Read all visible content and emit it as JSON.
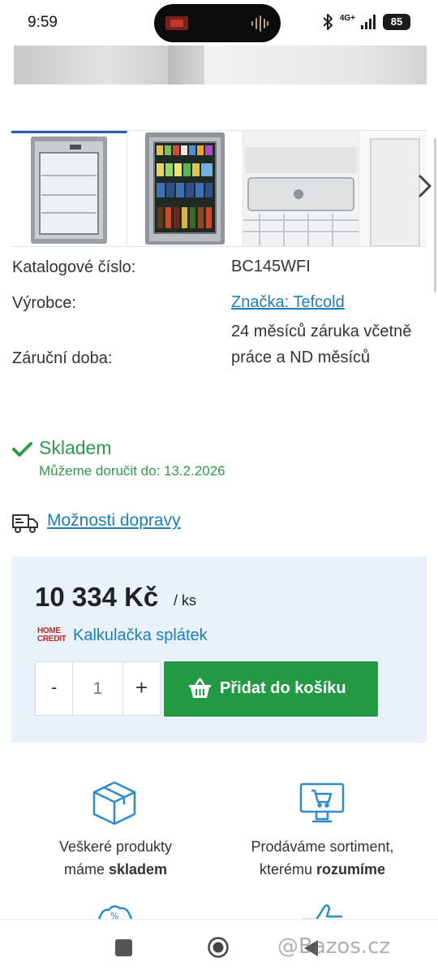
{
  "status_bar": {
    "time": "9:59",
    "network": "4G+",
    "battery": "85",
    "icons": [
      "app-notification-icon",
      "audio-wave-icon",
      "bluetooth-icon",
      "signal-icon",
      "battery-icon"
    ]
  },
  "gallery": {
    "thumbnails": [
      "glass-door-fridge-empty",
      "glass-door-fridge-stocked",
      "fridge-interior-detail",
      "fridge-side-detail"
    ],
    "next_icon": "chevron-right-icon",
    "active_color": "#2b5ea7"
  },
  "specs": {
    "rows": [
      {
        "label": "Katalogové číslo:",
        "value": "BC145WFI"
      },
      {
        "label": "Výrobce:",
        "value": "Značka: Tefcold"
      },
      {
        "label": "Záruční doba:",
        "value": "24 měsíců záruka včetně práce a ND měsíců"
      }
    ]
  },
  "stock": {
    "icon": "checkmark-icon",
    "title": "Skladem",
    "delivery": "Můžeme doručit do: 13.2.2026",
    "color": "#2e9c4a"
  },
  "shipping": {
    "icon": "truck-icon",
    "link": "Možnosti dopravy"
  },
  "purchase": {
    "price": "10 334 Kč",
    "unit": "/ ks",
    "home_credit": {
      "line1": "HOME",
      "line2": "CREDIT"
    },
    "calculator_link": "Kalkulačka splátek",
    "qty_minus": "-",
    "qty_value": "1",
    "qty_plus": "+",
    "add_to_cart": "Přidat do košíku",
    "button_color": "#229a44",
    "box_color": "#e9f2fa"
  },
  "features": [
    {
      "icon": "box-icon",
      "line1": "Veškeré produkty",
      "line2_prefix": "máme ",
      "line2_bold": "skladem"
    },
    {
      "icon": "monitor-cart-icon",
      "line1": "Prodáváme sortiment,",
      "line2_prefix": "kterému ",
      "line2_bold": "rozumíme"
    }
  ],
  "watermark": "@Bazos.cz",
  "colors": {
    "link": "#1a7fc1",
    "accent_red": "#d1211f"
  }
}
